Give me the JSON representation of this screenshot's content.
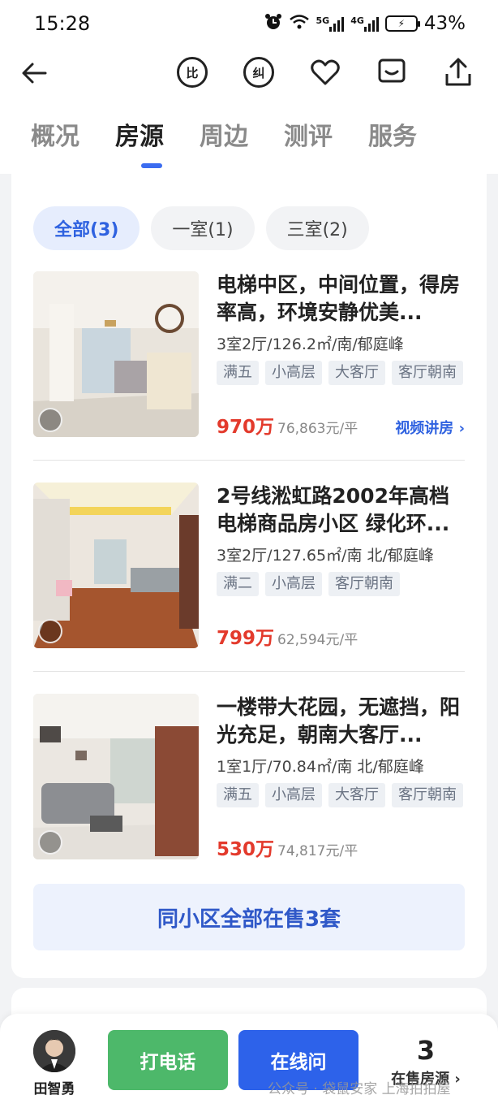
{
  "status_bar": {
    "time": "15:28",
    "battery": "43%",
    "net1": "5G",
    "net2": "4G"
  },
  "nav": {
    "compare_icon_text": "比",
    "correct_icon_text": "纠"
  },
  "tabs": [
    "概况",
    "房源",
    "周边",
    "测评",
    "服务"
  ],
  "active_tab": 1,
  "filters": [
    {
      "label": "全部(3)",
      "active": true
    },
    {
      "label": "一室(1)",
      "active": false
    },
    {
      "label": "三室(2)",
      "active": false
    }
  ],
  "listings": [
    {
      "title": "电梯中区，中间位置，得房率高，环境安静优美...",
      "spec": "3室2厅/126.2㎡/南/郁庭峰",
      "tags": [
        "满五",
        "小高层",
        "大客厅",
        "客厅朝南"
      ],
      "price": "970万",
      "unit_price": "76,863元/平",
      "video_link": "视频讲房 ›"
    },
    {
      "title": "2号线淞虹路2002年高档电梯商品房小区 绿化环...",
      "spec": "3室2厅/127.65㎡/南 北/郁庭峰",
      "tags": [
        "满二",
        "小高层",
        "客厅朝南"
      ],
      "price": "799万",
      "unit_price": "62,594元/平",
      "video_link": ""
    },
    {
      "title": "一楼带大花园，无遮挡，阳光充足，朝南大客厅...",
      "spec": "1室1厅/70.84㎡/南 北/郁庭峰",
      "tags": [
        "满五",
        "小高层",
        "大客厅",
        "客厅朝南"
      ],
      "price": "530万",
      "unit_price": "74,817元/平",
      "video_link": ""
    }
  ],
  "all_listings_button": "同小区全部在售3套",
  "bottom_bar": {
    "agent_name": "田智勇",
    "call_button": "打电话",
    "online_button": "在线问",
    "count": "3",
    "count_label": "在售房源 ›"
  },
  "watermark": "公众号 · 袋鼠安家 上海拍拍屋",
  "colors": {
    "accent": "#2d62ea",
    "price": "#e33a2c",
    "call": "#4db86a"
  }
}
